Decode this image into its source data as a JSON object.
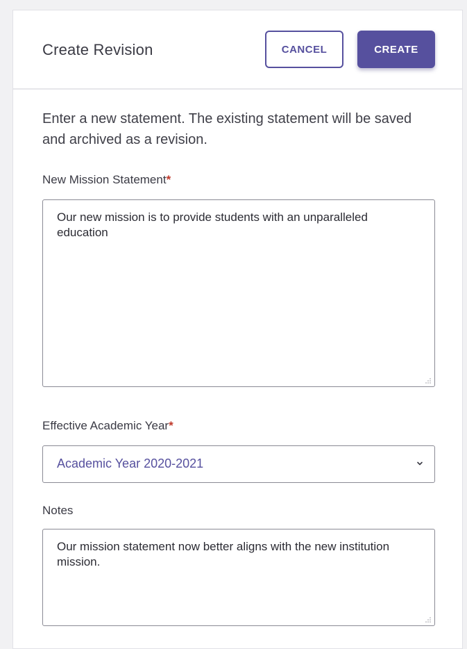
{
  "header": {
    "title": "Create Revision",
    "cancel_label": "CANCEL",
    "create_label": "CREATE"
  },
  "intro_text": "Enter a new statement. The existing statement will be saved and archived as a revision.",
  "mission": {
    "label": "New Mission Statement",
    "required_mark": "*",
    "value": "Our new mission is to provide students with an unparalleled education"
  },
  "academic_year": {
    "label": "Effective Academic Year",
    "required_mark": "*",
    "selected": "Academic Year 2020-2021",
    "icon": "chevron-down-icon"
  },
  "notes": {
    "label": "Notes",
    "value": "Our  mission statement now better aligns with the new institution mission."
  },
  "colors": {
    "accent": "#56509e",
    "required": "#c0392b",
    "text": "#3a3a44"
  }
}
